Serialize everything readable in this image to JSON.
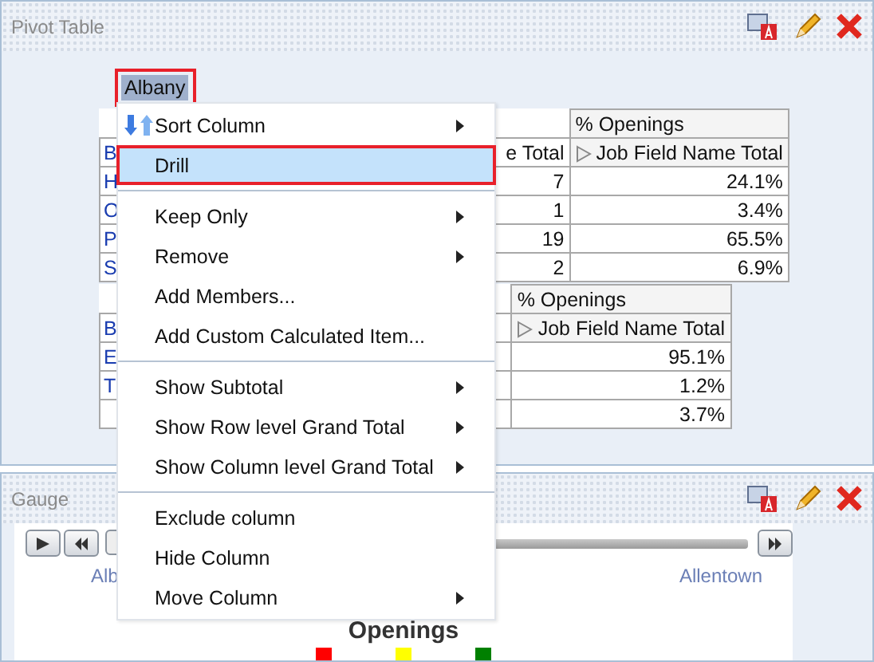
{
  "pivot_panel": {
    "title": "Pivot Table",
    "member_label": {
      "text": "Albany",
      "selected": true
    },
    "table_1": {
      "column_header": "% Openings",
      "subheader": {
        "row_label": "B",
        "count": "e Total",
        "measure": "Job Field Name Total"
      },
      "rows": [
        {
          "label": "H",
          "count": "7",
          "value": "24.1%"
        },
        {
          "label": "O",
          "count": "1",
          "value": "3.4%"
        },
        {
          "label": "P",
          "count": "19",
          "value": "65.5%"
        },
        {
          "label": "S",
          "count": "2",
          "value": "6.9%"
        }
      ]
    },
    "table_2": {
      "column_header": "% Openings",
      "subheader": {
        "row_label": "B",
        "measure": "Job Field Name Total"
      },
      "rows": [
        {
          "label": "E",
          "value": "95.1%"
        },
        {
          "label": "T",
          "value": "1.2%"
        },
        {
          "value": "3.7%"
        }
      ]
    }
  },
  "context_menu": [
    {
      "kind": "item",
      "label": "Sort Column",
      "icon": true,
      "submenu": true,
      "selected": false
    },
    {
      "kind": "item",
      "label": "Drill",
      "icon": false,
      "submenu": false,
      "selected": true
    },
    {
      "kind": "separator"
    },
    {
      "kind": "item",
      "label": "Keep Only",
      "icon": false,
      "submenu": true,
      "selected": false
    },
    {
      "kind": "item",
      "label": "Remove",
      "icon": false,
      "submenu": true,
      "selected": false
    },
    {
      "kind": "item",
      "label": "Add Members...",
      "icon": false,
      "submenu": false,
      "selected": false
    },
    {
      "kind": "item",
      "label": "Add Custom Calculated Item...",
      "icon": false,
      "submenu": false,
      "selected": false
    },
    {
      "kind": "separator"
    },
    {
      "kind": "item",
      "label": "Show Subtotal",
      "icon": false,
      "submenu": true,
      "selected": false
    },
    {
      "kind": "item",
      "label": "Show Row level Grand Total",
      "icon": false,
      "submenu": true,
      "selected": false
    },
    {
      "kind": "item",
      "label": "Show Column level Grand Total",
      "icon": false,
      "submenu": true,
      "selected": false
    },
    {
      "kind": "separator"
    },
    {
      "kind": "item",
      "label": "Exclude column",
      "icon": false,
      "submenu": false,
      "selected": false
    },
    {
      "kind": "item",
      "label": "Hide Column",
      "icon": false,
      "submenu": false,
      "selected": false
    },
    {
      "kind": "item",
      "label": "Move Column",
      "icon": false,
      "submenu": true,
      "selected": false
    }
  ],
  "gauge_panel": {
    "title": "Gauge",
    "slider": {
      "level": 0,
      "start_label": "Alb",
      "end_label": "Allentown"
    },
    "chart_title": "Openings",
    "legend": [
      {
        "color": "#ff0000"
      },
      {
        "color": "#ffff00"
      },
      {
        "color": "#008000"
      }
    ]
  }
}
